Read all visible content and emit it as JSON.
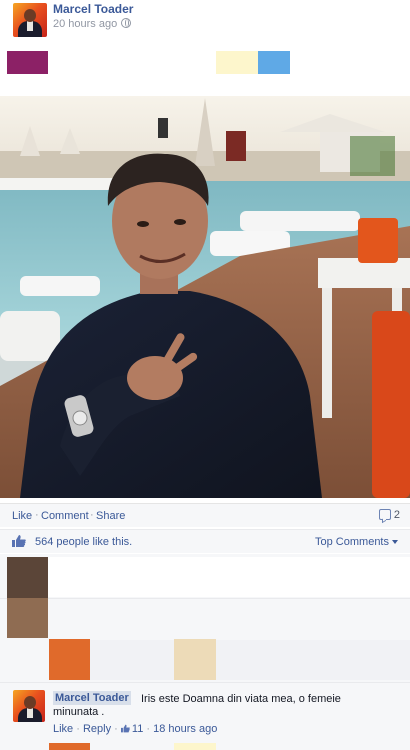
{
  "post": {
    "author": "Marcel Toader",
    "timestamp": "20 hours ago"
  },
  "colors": {
    "facebook_blue": "#3b5998",
    "swatch_magenta": "#8c2166",
    "swatch_cream": "#fdf6cc",
    "swatch_sky": "#5fa9e6",
    "swatch_brown_dark": "#5b4538",
    "swatch_brown_light": "#8f6c52",
    "swatch_orange": "#e06a2b",
    "swatch_beige": "#eddbb8"
  },
  "actions": {
    "like": "Like",
    "comment": "Comment",
    "share": "Share",
    "separator": "·",
    "comment_count": "2"
  },
  "likes": {
    "text": "564 people like this.",
    "sort_label": "Top Comments"
  },
  "comment": {
    "author": "Marcel Toader",
    "text_line1": "Iris este Doamna din viata mea, o femeie",
    "text_line2": "minunata .",
    "like": "Like",
    "reply": "Reply",
    "like_count": "11",
    "time": "18 hours ago",
    "separator": "·"
  },
  "icons": {
    "globe": "globe-icon",
    "comment": "comment-bubble-icon",
    "like": "thumbs-up-icon"
  }
}
